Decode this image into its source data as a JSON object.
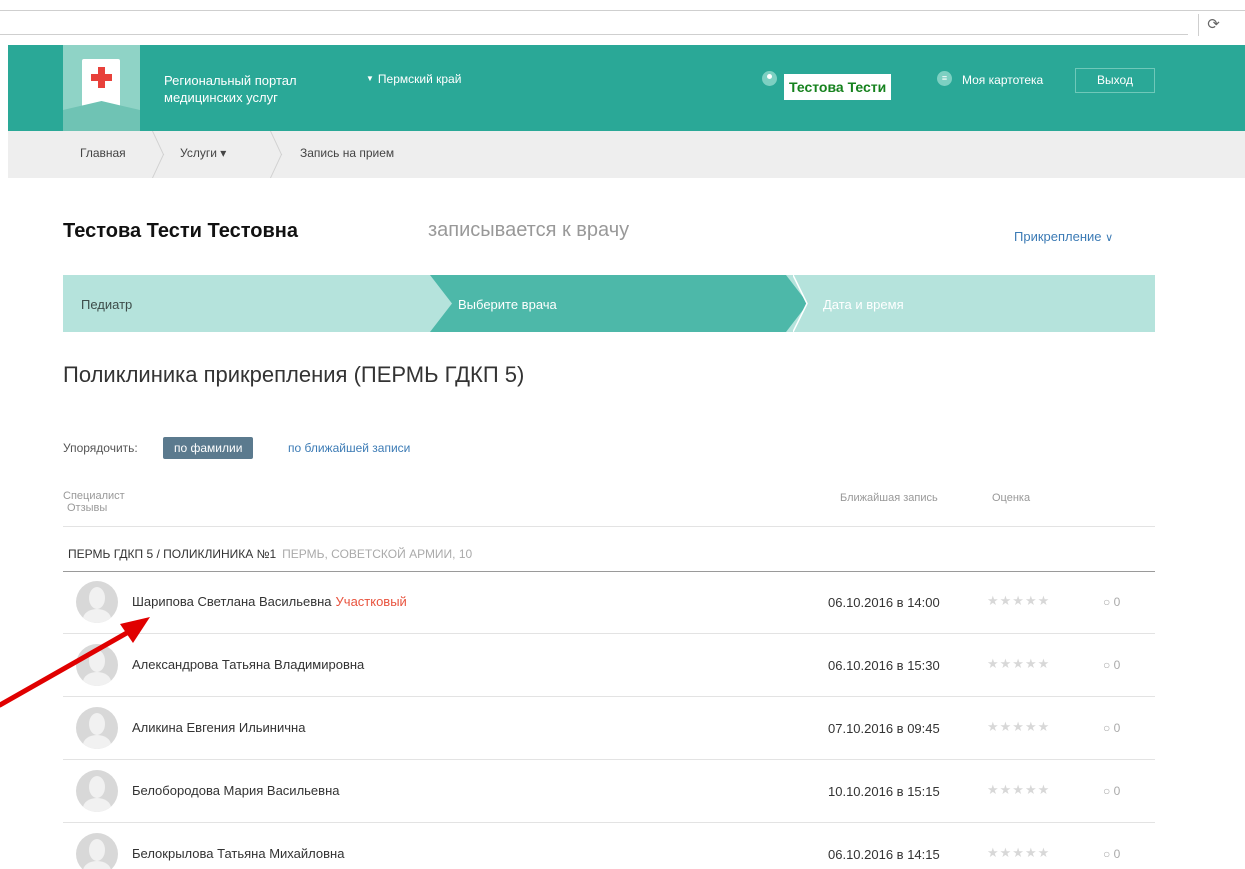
{
  "browser": {
    "reload_icon": "reload-icon"
  },
  "header": {
    "portal_name": "Региональный портал медицинских услуг",
    "region": "Пермский край",
    "user_name": "Тестова Тести",
    "card_link": "Моя картотека",
    "exit_label": "Выход",
    "brand_color": "#2aa897"
  },
  "breadcrumb": [
    {
      "label": "Главная"
    },
    {
      "label": "Услуги ▾"
    },
    {
      "label": "Запись на прием"
    }
  ],
  "patient": {
    "name": "Тестова Тести Тестовна",
    "action": "записывается к врачу",
    "attach_link": "Прикрепление"
  },
  "steps": [
    {
      "label": "Педиатр",
      "state": "done"
    },
    {
      "label": "Выберите врача",
      "state": "active"
    },
    {
      "label": "Дата и время",
      "state": "pending"
    }
  ],
  "clinic_title": "Поликлиника прикрепления (ПЕРМЬ ГДКП 5)",
  "sort": {
    "label": "Упорядочить:",
    "active": "по фамилии",
    "other": "по ближайшей записи"
  },
  "columns": {
    "specialist": "Специалист",
    "reviews": "Отзывы",
    "nearest": "Ближайшая запись",
    "rating": "Оценка"
  },
  "group": {
    "name": "ПЕРМЬ ГДКП 5 / ПОЛИКЛИНИКА №1",
    "address": "ПЕРМЬ, СОВЕТСКОЙ АРМИИ, 10"
  },
  "doctors": [
    {
      "name": "Шарипова Светлана Васильевна",
      "tag": "Участковый",
      "date": "06.10.2016 в 14:00",
      "stars": "★★★★★",
      "reviews": "0"
    },
    {
      "name": "Александрова Татьяна Владимировна",
      "tag": "",
      "date": "06.10.2016 в 15:30",
      "stars": "★★★★★",
      "reviews": "0"
    },
    {
      "name": "Аликина Евгения Ильинична",
      "tag": "",
      "date": "07.10.2016 в 09:45",
      "stars": "★★★★★",
      "reviews": "0"
    },
    {
      "name": "Белобородова Мария Васильевна",
      "tag": "",
      "date": "10.10.2016 в 15:15",
      "stars": "★★★★★",
      "reviews": "0"
    },
    {
      "name": "Белокрылова Татьяна Михайловна",
      "tag": "",
      "date": "06.10.2016 в 14:15",
      "stars": "★★★★★",
      "reviews": "0"
    }
  ],
  "colors": {
    "tag": "#e8533e",
    "arrow": "#e00000",
    "link": "#3c7bb5"
  }
}
